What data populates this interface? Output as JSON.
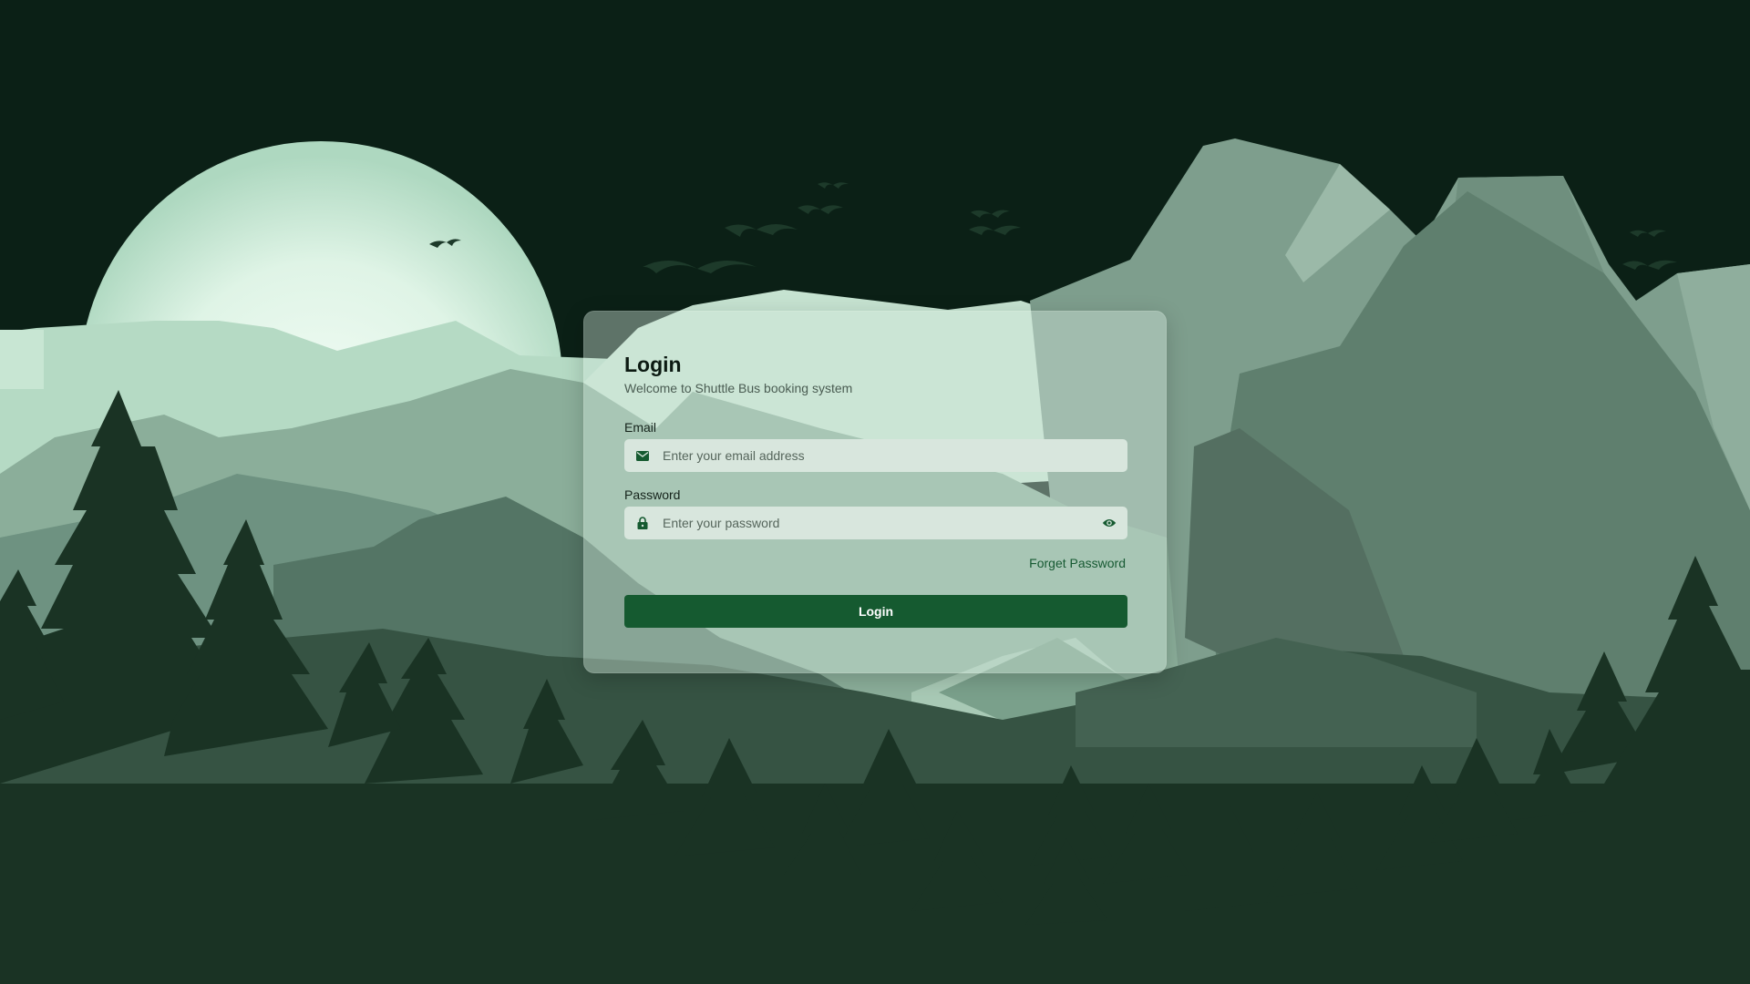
{
  "login": {
    "title": "Login",
    "subtitle": "Welcome to Shuttle Bus booking system",
    "email_label": "Email",
    "email_placeholder": "Enter your email address",
    "email_value": "",
    "password_label": "Password",
    "password_placeholder": "Enter your password",
    "password_value": "",
    "forgot_label": "Forget Password",
    "submit_label": "Login"
  },
  "icons": {
    "email": "envelope-icon",
    "password": "lock-icon",
    "toggle": "eye-icon"
  },
  "colors": {
    "sky": "#0b2016",
    "moon": "#e6f7ec",
    "primary_button": "#155a30",
    "link": "#175a33",
    "forest": "#1a3324"
  }
}
